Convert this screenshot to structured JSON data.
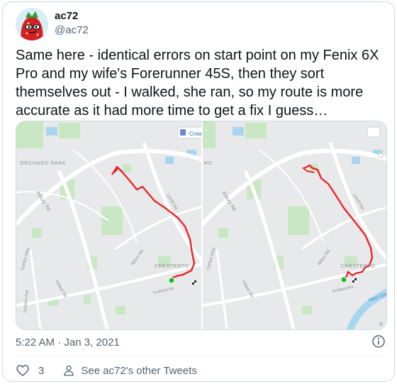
{
  "author": {
    "display_name": "ac72",
    "handle": "@ac72",
    "avatar_icon": "strawberry-character-avatar"
  },
  "tweet": {
    "text": "Same here - identical errors on start point on my Fenix 6X Pro and my wife's Forerunner 45S, then they sort themselves out - I walked, she ran, so my route is more accurate as it had more time to get a fix I guess…"
  },
  "media": {
    "left_map": {
      "labels": {
        "orchard_park": "ORCHARD PARK",
        "arbury_rd": "Arbury Rd",
        "carlton_way": "Carlton Way",
        "gilbert_rd": "Gilbert Rd",
        "stretten_ave": "Stretten Ave",
        "milton_rd": "Milton Rd",
        "lovell_rd": "Lovell Rd",
        "chesterton": "CHESTERTO",
        "scotland_rd": "Scotland Rd",
        "create_button": "Crea"
      }
    },
    "right_map": {
      "labels": {
        "rd_fragment": "RD",
        "arbury_rd": "Arbury Rd",
        "carlton_way": "Carlton Way",
        "gilbert_rd": "Gilbert Rd",
        "milton_rd": "Milton Rd",
        "lovell_rd": "Lovell Rd",
        "chesterton": "CHESTERTO",
        "scotland_rd": "Scotland Rd",
        "river_cam": "River Cam",
        "copyright": "©"
      }
    },
    "colors": {
      "route": "#e8262c",
      "start_marker": "#1fb82b",
      "map_background": "#e8e9ea",
      "park": "#c9e7c2",
      "water": "#a8d6ee"
    }
  },
  "meta": {
    "timestamp": "5:22 AM · Jan 3, 2021"
  },
  "actions": {
    "like_count": "3",
    "see_other_tweets": "See ac72's other Tweets"
  }
}
